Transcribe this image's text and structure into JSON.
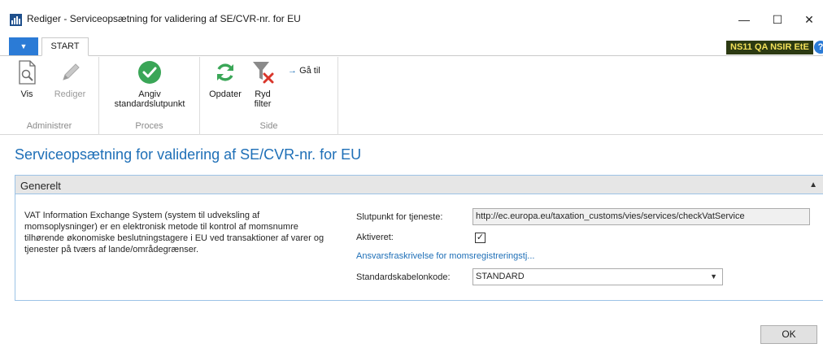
{
  "window": {
    "title": "Rediger - Serviceopsætning for validering af SE/CVR-nr. for EU",
    "minimize": "—",
    "maximize": "☐",
    "close": "✕",
    "app_icon": "dynamics-nav-icon"
  },
  "ribbon": {
    "app_menu_glyph": "▼",
    "tab_start": "START",
    "company_badge": "NS11 QA NSIR EtE",
    "help": "?",
    "groups": {
      "administrer": {
        "label": "Administrer",
        "vis": "Vis",
        "rediger": "Rediger"
      },
      "proces": {
        "label": "Proces",
        "angiv_line1": "Angiv",
        "angiv_line2": "standardslutpunkt"
      },
      "side": {
        "label": "Side",
        "opdater": "Opdater",
        "ryd_line1": "Ryd",
        "ryd_line2": "filter",
        "ga_til": "Gå til"
      }
    }
  },
  "page": {
    "title": "Serviceopsætning for validering af SE/CVR-nr. for EU"
  },
  "generelt": {
    "header": "Generelt",
    "description": "VAT Information Exchange System (system til udveksling af momsoplysninger) er en elektronisk metode til kontrol af momsnumre tilhørende økonomiske beslutningstagere i EU ved transaktioner af varer og tjenester på tværs af lande/områdegrænser.",
    "endpoint_label": "Slutpunkt for tjeneste:",
    "endpoint_value": "http://ec.europa.eu/taxation_customs/vies/services/checkVatService",
    "enabled_label": "Aktiveret:",
    "enabled_checked": true,
    "disclaimer_link": "Ansvarsfraskrivelse for momsregistreringstj...",
    "template_label": "Standardskabelonkode:",
    "template_value": "STANDARD"
  },
  "footer": {
    "ok": "OK"
  },
  "colors": {
    "accent": "#1e6fb7",
    "app_menu": "#2b7bd6",
    "badge_bg": "#2c3a12",
    "badge_fg": "#f2e05a",
    "check_green": "#3aa657",
    "clear_filter_red": "#d9362b"
  }
}
